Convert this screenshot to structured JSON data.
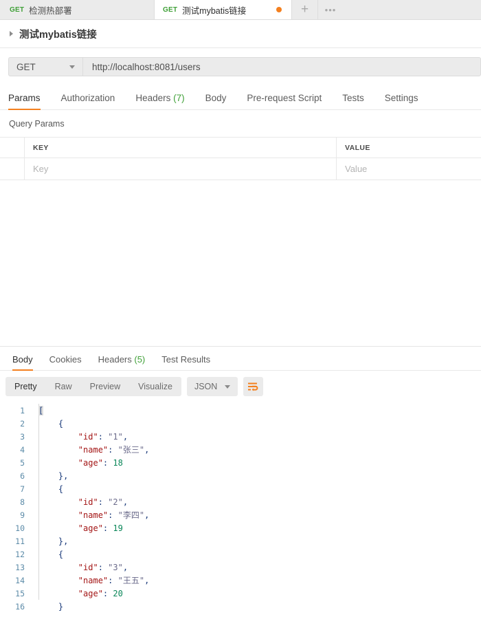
{
  "window": {
    "app": "Postman"
  },
  "tabs": {
    "items": [
      {
        "verb": "GET",
        "name": "检测热部署",
        "active": false,
        "unsaved": false
      },
      {
        "verb": "GET",
        "name": "测试mybatis链接",
        "active": true,
        "unsaved": true
      }
    ],
    "new_tab_icon": "plus-icon",
    "more_icon": "ellipsis-icon"
  },
  "breadcrumb": {
    "expand_icon": "triangle-right-icon",
    "title": "测试mybatis链接"
  },
  "request": {
    "method": "GET",
    "method_caret_icon": "chevron-down-icon",
    "url": "http://localhost:8081/users",
    "tabs": [
      {
        "label": "Params",
        "active": true
      },
      {
        "label": "Authorization",
        "active": false
      },
      {
        "label": "Headers",
        "count": "(7)",
        "active": false
      },
      {
        "label": "Body",
        "active": false
      },
      {
        "label": "Pre-request Script",
        "active": false
      },
      {
        "label": "Tests",
        "active": false
      },
      {
        "label": "Settings",
        "active": false
      }
    ]
  },
  "query_params": {
    "section_label": "Query Params",
    "columns": {
      "key": "KEY",
      "value": "VALUE"
    },
    "rows": [
      {
        "key_placeholder": "Key",
        "value_placeholder": "Value"
      }
    ]
  },
  "response": {
    "tabs": [
      {
        "label": "Body",
        "active": true
      },
      {
        "label": "Cookies",
        "active": false
      },
      {
        "label": "Headers",
        "count": "(5)",
        "active": false
      },
      {
        "label": "Test Results",
        "active": false
      }
    ],
    "view_modes": [
      {
        "label": "Pretty",
        "active": true
      },
      {
        "label": "Raw",
        "active": false
      },
      {
        "label": "Preview",
        "active": false
      },
      {
        "label": "Visualize",
        "active": false
      }
    ],
    "format": "JSON",
    "format_caret_icon": "chevron-down-icon",
    "wrap_icon": "word-wrap-icon",
    "body_lines": [
      {
        "n": "1",
        "tokens": [
          {
            "t": "[",
            "c": "br",
            "sel": true
          }
        ]
      },
      {
        "n": "2",
        "tokens": [
          {
            "t": "    ",
            "c": ""
          },
          {
            "t": "{",
            "c": "br"
          }
        ]
      },
      {
        "n": "3",
        "tokens": [
          {
            "t": "        ",
            "c": ""
          },
          {
            "t": "\"id\"",
            "c": "k"
          },
          {
            "t": ": ",
            "c": "p"
          },
          {
            "t": "\"1\"",
            "c": "s"
          },
          {
            "t": ",",
            "c": "p"
          }
        ]
      },
      {
        "n": "4",
        "tokens": [
          {
            "t": "        ",
            "c": ""
          },
          {
            "t": "\"name\"",
            "c": "k"
          },
          {
            "t": ": ",
            "c": "p"
          },
          {
            "t": "\"张三\"",
            "c": "s"
          },
          {
            "t": ",",
            "c": "p"
          }
        ]
      },
      {
        "n": "5",
        "tokens": [
          {
            "t": "        ",
            "c": ""
          },
          {
            "t": "\"age\"",
            "c": "k"
          },
          {
            "t": ": ",
            "c": "p"
          },
          {
            "t": "18",
            "c": "n"
          }
        ]
      },
      {
        "n": "6",
        "tokens": [
          {
            "t": "    ",
            "c": ""
          },
          {
            "t": "}",
            "c": "br"
          },
          {
            "t": ",",
            "c": "p"
          }
        ]
      },
      {
        "n": "7",
        "tokens": [
          {
            "t": "    ",
            "c": ""
          },
          {
            "t": "{",
            "c": "br"
          }
        ]
      },
      {
        "n": "8",
        "tokens": [
          {
            "t": "        ",
            "c": ""
          },
          {
            "t": "\"id\"",
            "c": "k"
          },
          {
            "t": ": ",
            "c": "p"
          },
          {
            "t": "\"2\"",
            "c": "s"
          },
          {
            "t": ",",
            "c": "p"
          }
        ]
      },
      {
        "n": "9",
        "tokens": [
          {
            "t": "        ",
            "c": ""
          },
          {
            "t": "\"name\"",
            "c": "k"
          },
          {
            "t": ": ",
            "c": "p"
          },
          {
            "t": "\"李四\"",
            "c": "s"
          },
          {
            "t": ",",
            "c": "p"
          }
        ]
      },
      {
        "n": "10",
        "tokens": [
          {
            "t": "        ",
            "c": ""
          },
          {
            "t": "\"age\"",
            "c": "k"
          },
          {
            "t": ": ",
            "c": "p"
          },
          {
            "t": "19",
            "c": "n"
          }
        ]
      },
      {
        "n": "11",
        "tokens": [
          {
            "t": "    ",
            "c": ""
          },
          {
            "t": "}",
            "c": "br"
          },
          {
            "t": ",",
            "c": "p"
          }
        ]
      },
      {
        "n": "12",
        "tokens": [
          {
            "t": "    ",
            "c": ""
          },
          {
            "t": "{",
            "c": "br"
          }
        ]
      },
      {
        "n": "13",
        "tokens": [
          {
            "t": "        ",
            "c": ""
          },
          {
            "t": "\"id\"",
            "c": "k"
          },
          {
            "t": ": ",
            "c": "p"
          },
          {
            "t": "\"3\"",
            "c": "s"
          },
          {
            "t": ",",
            "c": "p"
          }
        ]
      },
      {
        "n": "14",
        "tokens": [
          {
            "t": "        ",
            "c": ""
          },
          {
            "t": "\"name\"",
            "c": "k"
          },
          {
            "t": ": ",
            "c": "p"
          },
          {
            "t": "\"王五\"",
            "c": "s"
          },
          {
            "t": ",",
            "c": "p"
          }
        ]
      },
      {
        "n": "15",
        "tokens": [
          {
            "t": "        ",
            "c": ""
          },
          {
            "t": "\"age\"",
            "c": "k"
          },
          {
            "t": ": ",
            "c": "p"
          },
          {
            "t": "20",
            "c": "n"
          }
        ]
      },
      {
        "n": "16",
        "tokens": [
          {
            "t": "    ",
            "c": ""
          },
          {
            "t": "}",
            "c": "br"
          }
        ]
      }
    ],
    "parsed_json": [
      {
        "id": "1",
        "name": "张三",
        "age": 18
      },
      {
        "id": "2",
        "name": "李四",
        "age": 19
      },
      {
        "id": "3",
        "name": "王五",
        "age": 20
      }
    ]
  },
  "colors": {
    "accent": "#f4801f",
    "verb_get": "#3fa037",
    "count_green": "#3fa037",
    "json_key": "#a31515",
    "json_string": "#6a6a8a",
    "json_number": "#098658",
    "line_number": "#5c8ba8",
    "chrome_bg": "#ebebeb"
  }
}
